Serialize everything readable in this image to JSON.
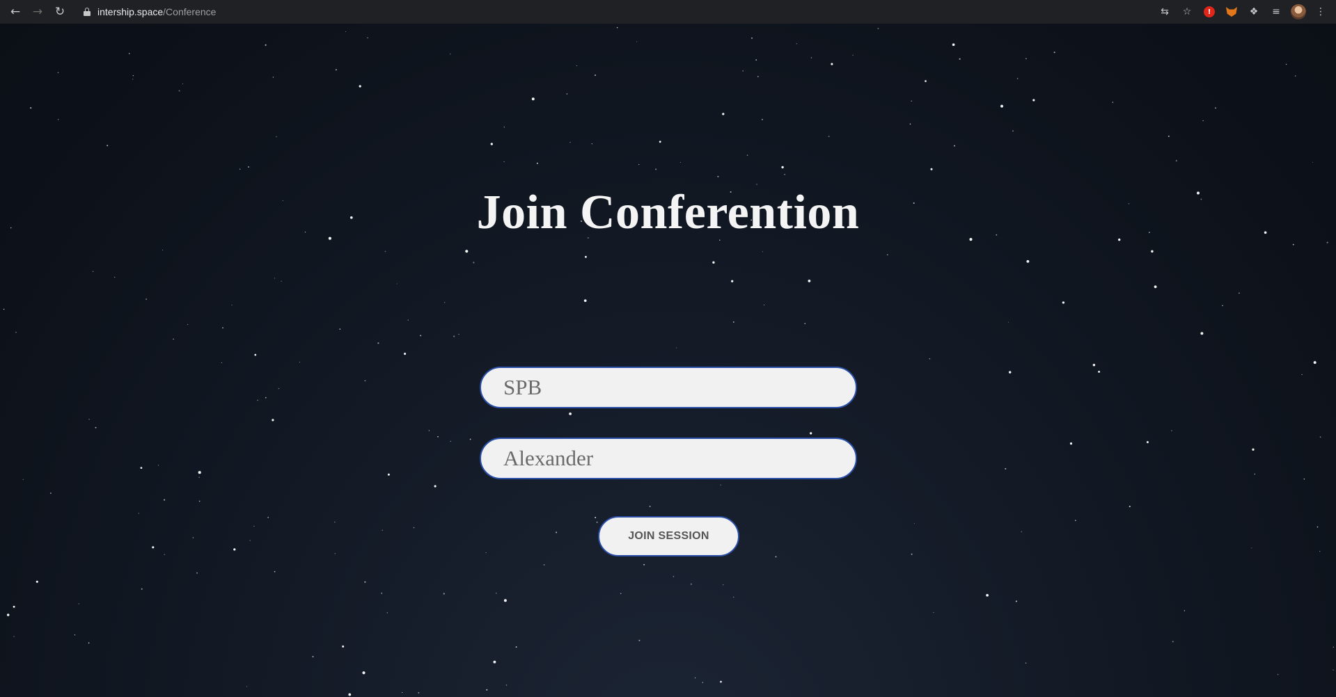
{
  "browser": {
    "url_host": "intership.space",
    "url_path": "/Conference"
  },
  "page": {
    "title": "Join Conferention",
    "conference_field": {
      "value": "SPB"
    },
    "name_field": {
      "value": "Alexander"
    },
    "join_button_label": "JOIN SESSION"
  }
}
